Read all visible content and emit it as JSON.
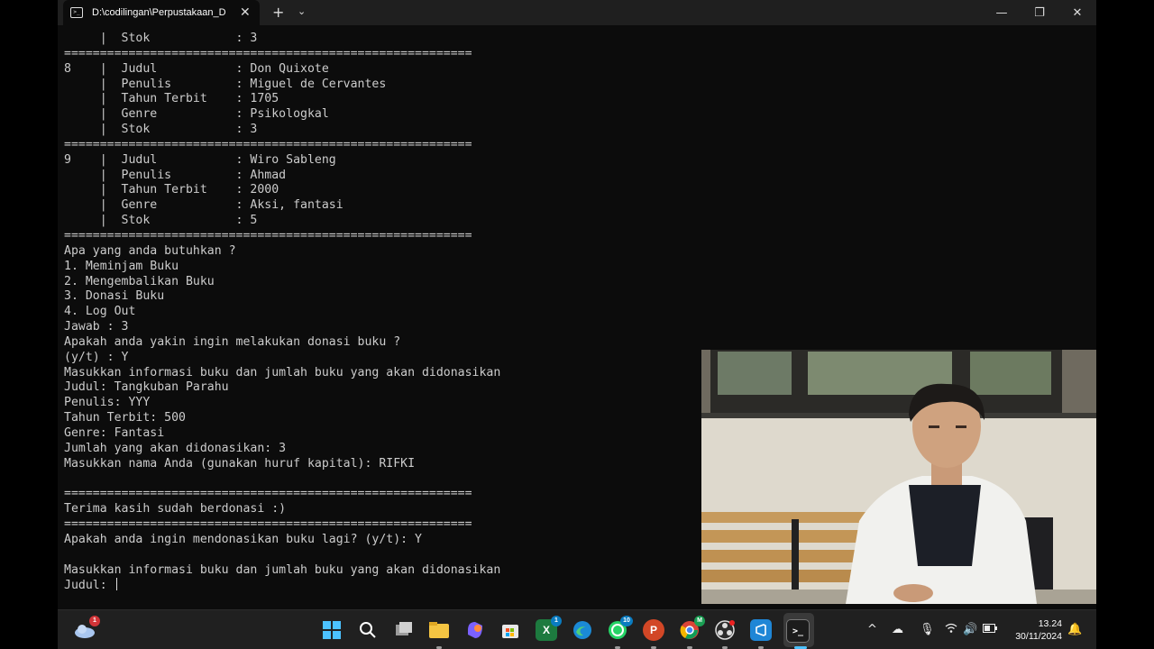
{
  "window": {
    "tab_title": "D:\\codilingan\\Perpustakaan_D",
    "tab_icon": "terminal-icon",
    "new_tab_label": "+",
    "dropdown_label": "⌄",
    "minimize_label": "—",
    "maximize_label": "❐",
    "close_label": "✕"
  },
  "terminal": {
    "lines": [
      "     |  Stok            : 3",
      "=========================================================",
      "8    |  Judul           : Don Quixote",
      "     |  Penulis         : Miguel de Cervantes",
      "     |  Tahun Terbit    : 1705",
      "     |  Genre           : Psikologkal",
      "     |  Stok            : 3",
      "=========================================================",
      "9    |  Judul           : Wiro Sableng",
      "     |  Penulis         : Ahmad",
      "     |  Tahun Terbit    : 2000",
      "     |  Genre           : Aksi, fantasi",
      "     |  Stok            : 5",
      "=========================================================",
      "Apa yang anda butuhkan ?",
      "1. Meminjam Buku",
      "2. Mengembalikan Buku",
      "3. Donasi Buku",
      "4. Log Out",
      "Jawab : 3",
      "Apakah anda yakin ingin melakukan donasi buku ?",
      "(y/t) : Y",
      "Masukkan informasi buku dan jumlah buku yang akan didonasikan",
      "Judul: Tangkuban Parahu",
      "Penulis: YYY",
      "Tahun Terbit: 500",
      "Genre: Fantasi",
      "Jumlah yang akan didonasikan: 3",
      "Masukkan nama Anda (gunakan huruf kapital): RIFKI",
      "",
      "=========================================================",
      "Terima kasih sudah berdonasi :)",
      "=========================================================",
      "Apakah anda ingin mendonasikan buku lagi? (y/t): Y",
      "",
      "Masukkan informasi buku dan jumlah buku yang akan didonasikan"
    ],
    "prompt": "Judul: "
  },
  "taskbar": {
    "weather_badge": "1",
    "apps": [
      {
        "name": "start-icon"
      },
      {
        "name": "search-icon"
      },
      {
        "name": "task-view-icon"
      },
      {
        "name": "file-explorer-icon"
      },
      {
        "name": "copilot-icon"
      },
      {
        "name": "microsoft-store-icon"
      },
      {
        "name": "excel-icon",
        "badge": "1"
      },
      {
        "name": "edge-icon"
      },
      {
        "name": "whatsapp-icon",
        "badge": "10"
      },
      {
        "name": "powerpoint-icon"
      },
      {
        "name": "chrome-icon",
        "badge": "M"
      },
      {
        "name": "obs-icon"
      },
      {
        "name": "vscode-icon"
      },
      {
        "name": "terminal-icon"
      }
    ],
    "tray": {
      "chevron": "^",
      "time": "13.24",
      "date": "30/11/2024"
    }
  },
  "colors": {
    "terminal_bg": "#0c0c0c",
    "terminal_fg": "#cccccc",
    "taskbar_bg": "#202020",
    "titlebar_bg": "#1f1f1f"
  }
}
